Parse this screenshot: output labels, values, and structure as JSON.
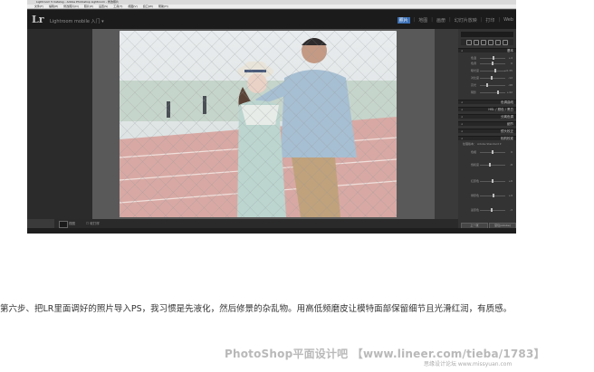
{
  "window": {
    "title": "Lightroom 5 Catalog - Adobe Photoshop Lightroom - 修改照片",
    "menu": [
      "文件(F)",
      "编辑(E)",
      "修改照片(D)",
      "照片(P)",
      "设置(S)",
      "工具(T)",
      "视图(V)",
      "窗口(W)",
      "帮助(H)"
    ]
  },
  "identity": {
    "logo": "Lr",
    "subtitle": "Lightroom mobile 入门 ▾"
  },
  "modules": [
    {
      "label": "照片",
      "active": true
    },
    {
      "label": "地图",
      "active": false
    },
    {
      "label": "画册",
      "active": false
    },
    {
      "label": "幻灯片放映",
      "active": false
    },
    {
      "label": "打印",
      "active": false
    },
    {
      "label": "Web",
      "active": false
    }
  ],
  "right_panel": {
    "histogram_label": "直方图",
    "sections": {
      "basic": "基本",
      "tone_curve": "色调曲线",
      "hsl": "HSL / 颜色 / 黑白",
      "split_tone": "分离色调",
      "detail": "细节",
      "lens": "镜头校正",
      "camera": "相机校准"
    },
    "profile_label": "处理版本：",
    "profile_value": "Adobe Standard ▾",
    "sliders": [
      {
        "label": "色温",
        "pos": 0.55,
        "value": "+4"
      },
      {
        "label": "色调",
        "pos": 0.5,
        "value": "0"
      },
      {
        "label": "曝光度",
        "pos": 0.6,
        "value": "+0.35"
      },
      {
        "label": "对比度",
        "pos": 0.45,
        "value": "-12"
      },
      {
        "label": "高光",
        "pos": 0.3,
        "value": "-48"
      },
      {
        "label": "阴影",
        "pos": 0.7,
        "value": "+42"
      },
      {
        "label": "色相",
        "pos": 0.5,
        "value": "0"
      },
      {
        "label": "饱和度",
        "pos": 0.4,
        "value": "-8"
      },
      {
        "label": "红原色",
        "pos": 0.5,
        "value": "+6"
      },
      {
        "label": "绿原色",
        "pos": 0.55,
        "value": "+9"
      },
      {
        "label": "蓝原色",
        "pos": 0.45,
        "value": "-3"
      }
    ],
    "prev_button": "上一张",
    "reset_button": "复位(Adobe)"
  },
  "bottombar": {
    "view_label": "视图",
    "softproof_label": "软打样"
  },
  "caption": "第六步、把LR里面调好的照片导入PS，我习惯是先液化，然后修景的杂乱物。用高低频磨皮让模特面部保留细节且光滑红润，有质感。",
  "watermark": "PhotoShop平面设计吧 【www.lineer.com/tieba/1783】",
  "watermark_small": "思缘设计论坛  www.missyuan.com"
}
